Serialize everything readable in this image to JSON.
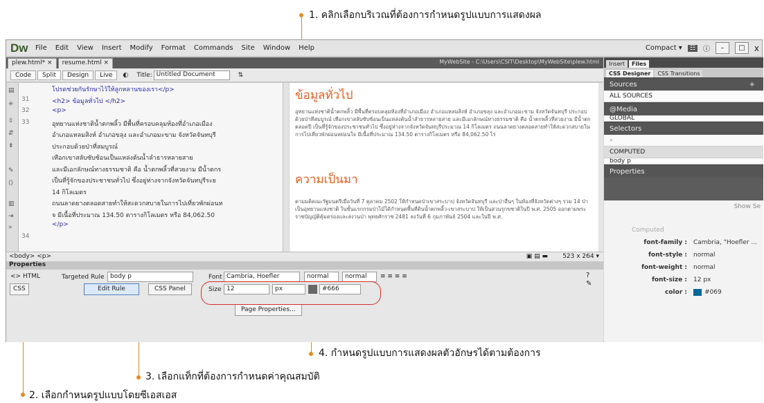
{
  "annotations": {
    "a1": "1. คลิกเลือกบริเวณที่ต้องการกำหนดรูปแบบการแสดงผล",
    "a2": "2. เลือกกำหนดรูปแบบโดยซีเอสเอส",
    "a3": "3. เลือกแท็กที่ต้องการกำหนดค่าคุณสมบัติ",
    "a4": "4. กำหนดรูปแบบการแสดงผลตัวอักษรได้ตามต้องการ"
  },
  "app": {
    "logo": "Dw",
    "menus": [
      "File",
      "Edit",
      "View",
      "Insert",
      "Modify",
      "Format",
      "Commands",
      "Site",
      "Window",
      "Help"
    ],
    "workspace": "Compact ▾",
    "tabs": [
      "plew.html* ×",
      "resume.html ×"
    ],
    "site_path": "MyWebSite - C:\\Users\\CSIT\\Desktop\\MyWebSite\\plew.html",
    "views": [
      "Code",
      "Split",
      "Design",
      "Live"
    ],
    "title_label": "Title:",
    "title_value": "Untitled Document"
  },
  "code": {
    "lines": [
      {
        "num": "",
        "text": "โปรดช่วยกันรักษาไว้ให้ลูกหลานของเรา</p>"
      },
      {
        "num": "31",
        "text": "<h2> ข้อมูลทั่วไป </h2>"
      },
      {
        "num": "32",
        "text": "<p>"
      },
      {
        "num": "33",
        "text": "อุทยานแห่งชาติน้ำตกพลิ้ว มีพื้นที่ครอบคลุมท้องที่อำเภอเมือง"
      },
      {
        "num": "",
        "text": "อำเภอแหลมสิงห์ อำเภอขลุง และอำเภอมะขาม จังหวัดจันทบุรี"
      },
      {
        "num": "",
        "text": "ประกอบด้วยป่าที่สมบูรณ์"
      },
      {
        "num": "",
        "text": "เทือกเขาสลับซับซ้อนเป็นแหล่งต้นน้ำลำธารหลายสาย"
      },
      {
        "num": "",
        "text": "และมีเอกลักษณ์ทางธรรมชาติ คือ น้ำตกพลิ้วที่สวยงาม มีน้ำตกร"
      },
      {
        "num": "",
        "text": "เป็นที่รู้จักของประชาชนทั่วไป ซึ่งอยู่ห่างจากจังหวัดจันทบุรีระย"
      },
      {
        "num": "",
        "text": "14 กิโลเมตร"
      },
      {
        "num": "",
        "text": "ถนนลาดยางตลอดสายทำให้สะดวกสบายในการไปเที่ยวพักผ่อนห"
      },
      {
        "num": "",
        "text": "จ มีเนื้อที่ประมาณ 134.50 ตารางกิโลเมตร หรือ 84,062.50"
      },
      {
        "num": "",
        "text": "</p>"
      },
      {
        "num": "34",
        "text": ""
      }
    ]
  },
  "design": {
    "h1": "ข้อมูลทั่วไป",
    "p1": "อุทยานแห่งชาติน้ำตกพลิ้ว มีพื้นที่ครอบคลุมท้องที่อำเภอเมือง อำเภอแหลมสิงห์ อำเภอขลุง และอำเภอมะขาม จังหวัดจันทบุรี ประกอบด้วยป่าที่สมบูรณ์ เทือกเขาสลับซับซ้อนเป็นแหล่งต้นน้ำลำธารหลายสาย และมีเอกลักษณ์ทางธรรมชาติ คือ น้ำตกพลิ้วที่สวยงาม มีน้ำตกตลอดปี เป็นที่รู้จักของประชาชนทั่วไป ซึ่งอยู่ห่างจากจังหวัดจันทบุรีประมาณ 14 กิโลเมตร ถนนลาดยางตลอดสายทำให้สะดวกสบายในการไปเที่ยวพักผ่อนหย่อนใจ มีเนื้อที่ประมาณ 134.50 ตารางกิโลเมตร หรือ 84,062.50 ไร่",
    "h2": "ความเป็นมา",
    "p2": "ตามมติคณะรัฐมนตรีเมื่อวันที่ 7 ตุลาคม 2502 ให้กำหนดป่าเขาสระบาป จังหวัดจันทบุรี และป่าอื่นๆ ในท้องที่จังหวัดต่างๆ รวม 14 ป่า เป็นอุทยานแห่งชาติ ในชั้นแรกกรมป่าไม้ได้กำหนดพื้นที่ดินน้ำตกพลิ้ว-เขาสระบาป ให้เป็นสวนรุกขชาติในปี พ.ศ. 2505 ออกตามพระราชบัญญัติคุ้มครองและสงวนป่า พุทธศักราช 2481 ลงวันที่ 6 กุมภาพันธ์ 2504 และในปี พ.ศ."
  },
  "status": {
    "tag_path": "<body> <p>",
    "window_size": "523 x 264 ▾"
  },
  "properties": {
    "panel_title": "Properties",
    "html_btn": "<> HTML",
    "css_btn": "CSS",
    "targeted_rule_label": "Targeted Rule",
    "targeted_rule": "body p",
    "edit_rule": "Edit Rule",
    "css_panel": "CSS Panel",
    "font_label": "Font",
    "font_value": "Cambria, Hoefler",
    "weight": "normal",
    "style": "normal",
    "size_label": "Size",
    "size_value": "12",
    "size_unit": "px",
    "color_value": "#666",
    "color_hex": "#666666",
    "page_properties": "Page Properties..."
  },
  "right_panel": {
    "tabs": [
      "Insert",
      "Files"
    ],
    "sub_tabs": [
      "CSS Designer",
      "CSS Transitions"
    ],
    "sources_title": "Sources",
    "all_sources": "ALL SOURCES",
    "media_title": "@Media",
    "global": "GLOBAL",
    "selectors_title": "Selectors",
    "computed_item": "COMPUTED",
    "body_p": "body p",
    "properties_title": "Properties",
    "show_set": "Show Se",
    "computed_label": "Computed",
    "props": [
      {
        "key": "font-family :",
        "value": "Cambria, \"Hoefler ..."
      },
      {
        "key": "font-style :",
        "value": "normal"
      },
      {
        "key": "font-weight :",
        "value": "normal"
      },
      {
        "key": "font-size :",
        "value": "12 px"
      },
      {
        "key": "color :",
        "value": "#069"
      }
    ],
    "color_swatch": "#006699"
  }
}
